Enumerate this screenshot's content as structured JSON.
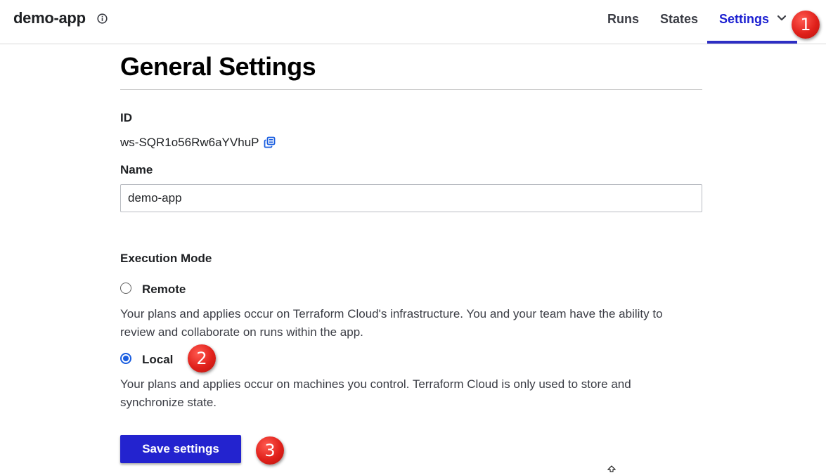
{
  "header": {
    "workspace_name": "demo-app",
    "nav": [
      {
        "label": "Runs"
      },
      {
        "label": "States"
      },
      {
        "label": "Settings",
        "active": true
      }
    ],
    "info_icon": "info-circle-icon",
    "dropdown_icon": "chevron-down-icon",
    "accent_color": "#2d2ec4"
  },
  "annotations": [
    "1",
    "2",
    "3"
  ],
  "main": {
    "title": "General Settings",
    "id_label": "ID",
    "id_value": "ws-SQR1o56Rw6aYVhuP",
    "copy_icon": "copy-icon",
    "name_label": "Name",
    "name_value": "demo-app",
    "execution_mode_label": "Execution Mode",
    "options": [
      {
        "label": "Remote",
        "selected": false,
        "description": "Your plans and applies occur on Terraform Cloud's infrastructure. You and your team have the ability to review and collaborate on runs within the app."
      },
      {
        "label": "Local",
        "selected": true,
        "description": "Your plans and applies occur on machines you control. Terraform Cloud is only used to store and synchronize state."
      }
    ],
    "save_label": "Save settings",
    "button_color": "#2323cf"
  }
}
